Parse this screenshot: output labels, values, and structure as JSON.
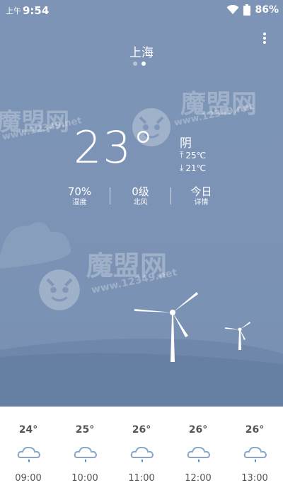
{
  "status_bar": {
    "ampm": "上午",
    "time": "9:54",
    "battery": "86%",
    "icons": [
      "wifi-icon",
      "battery-icon"
    ]
  },
  "header": {
    "city": "上海",
    "pages": 2,
    "active_page": 2,
    "menu_icon": "more-vertical-icon"
  },
  "current": {
    "temperature": "23°",
    "condition": "阴",
    "high": "25℃",
    "low": "21℃"
  },
  "stats": [
    {
      "value": "70%",
      "label": "湿度"
    },
    {
      "value": "0级",
      "label": "北风"
    },
    {
      "value": "今日",
      "label": "详情"
    }
  ],
  "watermark": {
    "brand": "魔盟网",
    "url": "www.12349.net"
  },
  "hourly": [
    {
      "temp": "24°",
      "time": "09:00",
      "icon": "light-rain-icon"
    },
    {
      "temp": "25°",
      "time": "10:00",
      "icon": "light-rain-icon"
    },
    {
      "temp": "26°",
      "time": "11:00",
      "icon": "light-rain-icon"
    },
    {
      "temp": "26°",
      "time": "12:00",
      "icon": "light-rain-icon"
    },
    {
      "temp": "26°",
      "time": "13:00",
      "icon": "light-rain-icon"
    }
  ],
  "colors": {
    "sky": "#7d94b6",
    "hill_back": "#6a82a6",
    "hill_front": "#5f789d",
    "cloud": "#8fa4c2",
    "rain_icon": "#8aa6c6"
  }
}
